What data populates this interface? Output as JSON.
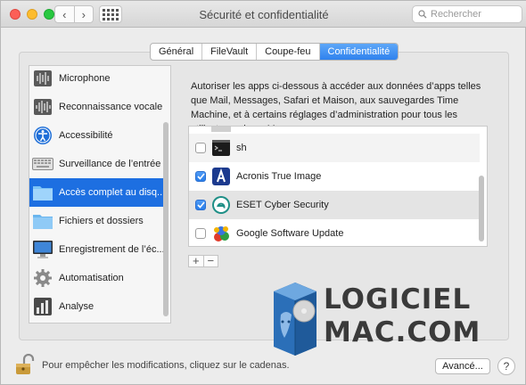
{
  "window": {
    "title": "Sécurité et confidentialité",
    "search_placeholder": "Rechercher",
    "nav_back": "‹",
    "nav_forward": "›"
  },
  "tabs": [
    {
      "label": "Général",
      "active": false
    },
    {
      "label": "FileVault",
      "active": false
    },
    {
      "label": "Coupe-feu",
      "active": false
    },
    {
      "label": "Confidentialité",
      "active": true
    }
  ],
  "sidebar": {
    "items": [
      {
        "label": "Microphone",
        "icon": "microphone-icon"
      },
      {
        "label": "Reconnaissance vocale",
        "icon": "waveform-icon"
      },
      {
        "label": "Accessibilité",
        "icon": "accessibility-icon"
      },
      {
        "label": "Surveillance de l’entrée",
        "icon": "keyboard-icon"
      },
      {
        "label": "Accès complet au disq...",
        "icon": "folder-icon",
        "selected": true
      },
      {
        "label": "Fichiers et dossiers",
        "icon": "folder-icon"
      },
      {
        "label": "Enregistrement de l’éc...",
        "icon": "display-icon"
      },
      {
        "label": "Automatisation",
        "icon": "gear-icon"
      },
      {
        "label": "Analyse",
        "icon": "chart-icon"
      }
    ]
  },
  "description": "Autoriser les apps ci-dessous à accéder aux données d’apps telles que Mail, Messages, Safari et Maison, aux sauvegardes Time Machine, et à certains réglages d’administration pour tous les utilisateurs de ce Mac.",
  "apps": [
    {
      "name": "sh",
      "checked": false,
      "icon": "terminal-icon"
    },
    {
      "name": "Acronis True Image",
      "checked": true,
      "icon": "acronis-icon"
    },
    {
      "name": "ESET Cyber Security",
      "checked": true,
      "icon": "eset-icon"
    },
    {
      "name": "Google Software Update",
      "checked": false,
      "icon": "google-update-icon"
    }
  ],
  "list_controls": {
    "add": "+",
    "remove": "−"
  },
  "watermark": {
    "line1": "LOGICIEL",
    "line2": "MAC.COM"
  },
  "footer": {
    "lock_text": "Pour empêcher les modifications, cliquez sur le cadenas.",
    "advanced_label": "Avancé...",
    "help_label": "?"
  },
  "colors": {
    "accent": "#1d6fe1",
    "tab_active": "#2f82ee"
  }
}
